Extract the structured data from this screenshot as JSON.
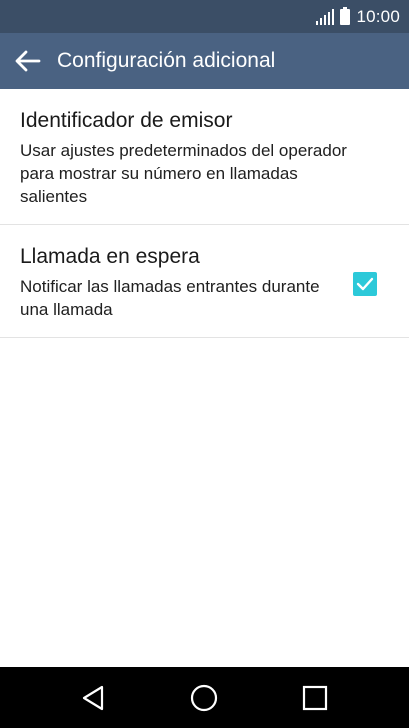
{
  "status_bar": {
    "time": "10:00",
    "icons": [
      "signal-icon",
      "battery-icon"
    ]
  },
  "app_bar": {
    "title": "Configuración adicional",
    "back_icon": "arrow-left-icon"
  },
  "preferences": [
    {
      "title": "Identificador de emisor",
      "summary": "Usar ajustes predeterminados del operador para mostrar su número en llamadas salientes"
    },
    {
      "title": "Llamada en espera",
      "summary": "Notificar las llamadas entrantes durante una llamada",
      "checked": true
    }
  ],
  "nav_bar": {
    "icons": [
      "back-triangle-icon",
      "home-circle-icon",
      "recents-square-icon"
    ]
  },
  "colors": {
    "status_bar": "#3b4e66",
    "app_bar": "#4a6282",
    "accent": "#2cc9d9",
    "nav_bar": "#000000"
  }
}
